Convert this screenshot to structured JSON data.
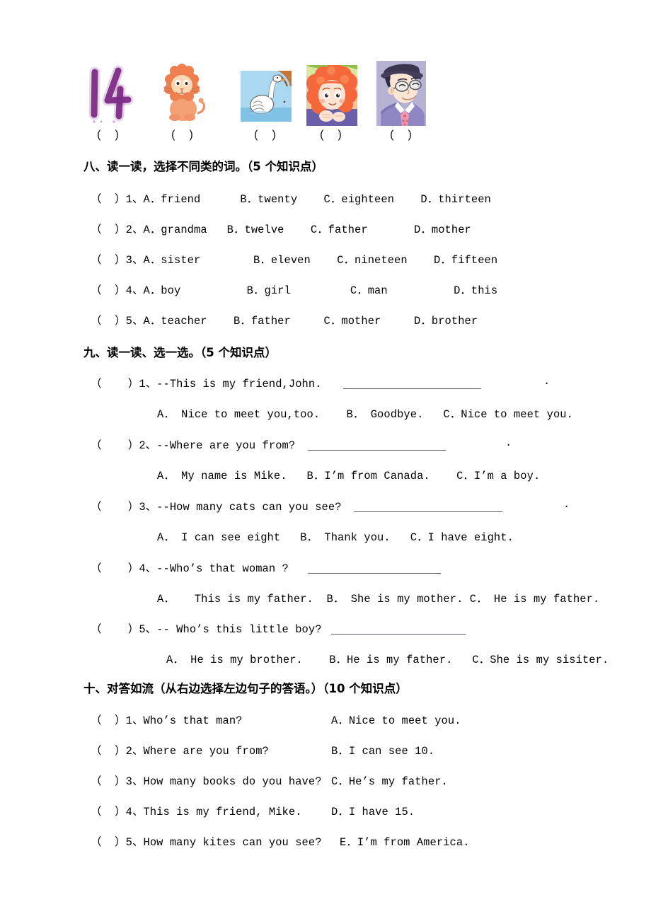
{
  "document": {
    "type": "english-exam-worksheet",
    "page_background": "#ffffff"
  },
  "picture_row": {
    "items": [
      {
        "id": "pic-number-14",
        "description": "handwritten purple number 14",
        "caption": "(  )",
        "digits": "14"
      },
      {
        "id": "pic-lion",
        "description": "orange cartoon lion sitting",
        "caption": "(  )"
      },
      {
        "id": "pic-swan",
        "description": "white swan on blue water",
        "caption": "(  )"
      },
      {
        "id": "pic-girl",
        "description": "cartoon girl with red curly hair",
        "caption": "(  )"
      },
      {
        "id": "pic-man",
        "description": "cartoon man with hat, glasses, purple suit and pink tie",
        "caption": "(  )"
      }
    ]
  },
  "section_eight": {
    "heading": "八、读一读，选择不同类的词。（5 个知识点）",
    "questions": [
      {
        "bracket": "（  ）",
        "number": "1、",
        "options": "A．friend      B．twenty    C．eighteen    D．thirteen"
      },
      {
        "bracket": "（  ）",
        "number": "2、",
        "options": "A．grandma   B．twelve    C．father       D．mother"
      },
      {
        "bracket": "（  ）",
        "number": "3、",
        "options": "A．sister        B．eleven    C．nineteen    D．fifteen"
      },
      {
        "bracket": "（  ）",
        "number": "4、",
        "options": "A．boy          B．girl         C．man          D．this"
      },
      {
        "bracket": "（  ）",
        "number": "5、",
        "options": "A．teacher    B．father     C．mother     D．brother"
      }
    ]
  },
  "section_nine": {
    "heading": "九、读一读、选一选。（5 个知识点）",
    "questions": [
      {
        "bracket": "（    ）",
        "number": "1、",
        "prompt": "--This is my friend,John.",
        "trailing_period": ".",
        "options": "A． Nice to meet you,too.    B． Goodbye.   C．Nice to meet you."
      },
      {
        "bracket": "（    ）",
        "number": "2、",
        "prompt": "--Where are you from?",
        "trailing_period": ".",
        "options": "A． My name is Mike.   B．I’m from Canada.    C．I’m a boy."
      },
      {
        "bracket": "（    ）",
        "number": "3、",
        "prompt": "--How many cats can you see?",
        "trailing_period": ".",
        "options": "A． I can see eight   B． Thank you.   C．I have eight."
      },
      {
        "bracket": "（    ）",
        "number": "4、",
        "prompt": "--Who’s that woman ?",
        "trailing_period": "",
        "options": "A．   This is my father.  B． She is my mother. C． He is my father."
      },
      {
        "bracket": "（    ）",
        "number": "5、",
        "prompt": "-- Who’s this little boy?",
        "trailing_period": "",
        "options": "A． He is my brother.    B．He is my father.   C．She is my sisiter."
      }
    ]
  },
  "section_ten": {
    "heading": "十、对答如流（从右边选择左边句子的答语。）（10 个知识点）",
    "rows": [
      {
        "bracket": "（  ）",
        "number": "1、",
        "left": "Who’s that man?",
        "right": "A．Nice to meet you."
      },
      {
        "bracket": "（  ）",
        "number": "2、",
        "left": "Where are you from?",
        "right": "B．I can see 10."
      },
      {
        "bracket": "（  ）",
        "number": "3、",
        "left": "How many books do you have?",
        "right": "C．He’s my father."
      },
      {
        "bracket": "（  ）",
        "number": "4、",
        "left": "This is my friend, Mike.",
        "right": "D．I have 15."
      },
      {
        "bracket": "（  ）",
        "number": "5、",
        "left": "How many kites can you see?",
        "right": "E．I’m from America."
      }
    ]
  }
}
